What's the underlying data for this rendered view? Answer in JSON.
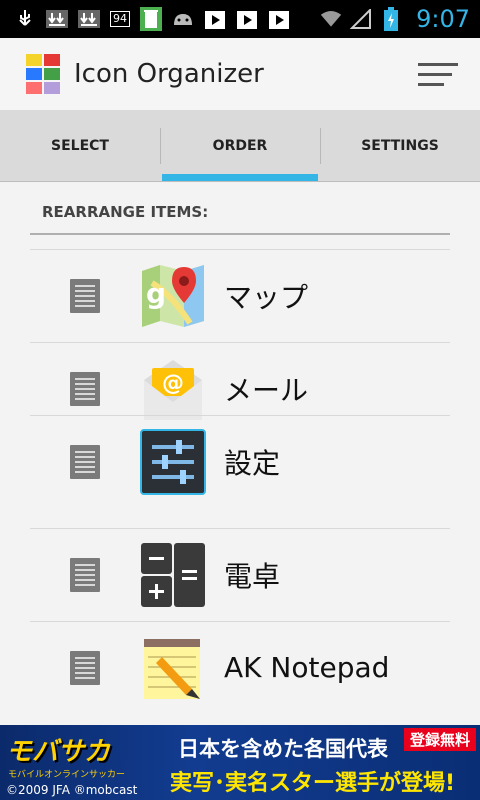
{
  "statusbar": {
    "badge": "94",
    "time": "9:07",
    "accent": "#33b5e5"
  },
  "app": {
    "title": "Icon Organizer",
    "icon": "four-color-grid-icon",
    "menu_icon": "overflow-menu-icon"
  },
  "tabs": [
    {
      "label": "SELECT",
      "active": false
    },
    {
      "label": "ORDER",
      "active": true
    },
    {
      "label": "SETTINGS",
      "active": false
    }
  ],
  "section": {
    "title": "REARRANGE ITEMS:"
  },
  "items": [
    {
      "label": "マップ",
      "icon": "maps-icon"
    },
    {
      "label": "メール",
      "icon": "mail-icon"
    },
    {
      "label": "設定",
      "icon": "settings-icon"
    },
    {
      "label": "電卓",
      "icon": "calculator-icon"
    },
    {
      "label": "AK Notepad",
      "icon": "notepad-icon"
    }
  ],
  "ad": {
    "logo": "モバサカ",
    "logo_sub": "モバイルオンラインサッカー",
    "copyright": "©2009 JFA ®mobcast",
    "line1": "日本を含めた各国代表",
    "line2": "実写･実名スター選手が登場!",
    "tag": "登録無料"
  }
}
